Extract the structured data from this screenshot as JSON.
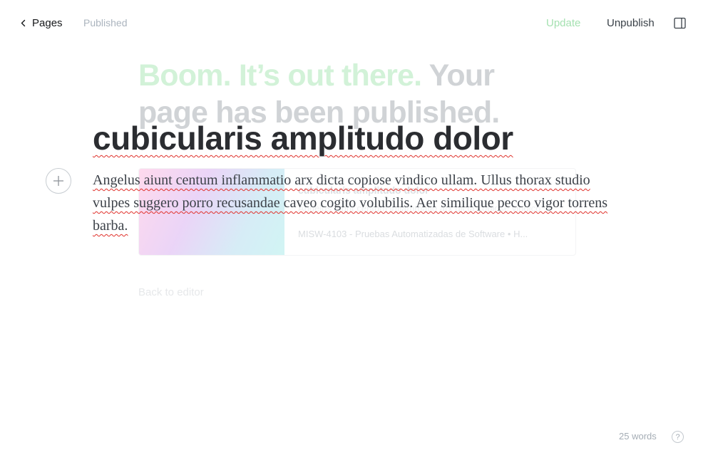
{
  "topbar": {
    "back_label": "Pages",
    "status": "Published",
    "update_label": "Update",
    "unpublish_label": "Unpublish"
  },
  "overlay": {
    "title_accent": "Boom. It’s out there.",
    "title_rest": "Your page has been published.",
    "bookmark": {
      "title": "cubicularis amplitudo dolor",
      "description": "Angelus aiunt centum inflammatio arx dicta copiose vindico",
      "site": "MISW-4103 - Pruebas Automatizadas de Software",
      "separator": "•",
      "author_truncated": "H..."
    },
    "back_to_editor": "Back to editor"
  },
  "editor": {
    "title": "cubicularis amplitudo dolor",
    "body": "Angelus aiunt centum inflammatio arx dicta copiose vindico ullam. Ullus thorax studio vulpes suggero porro recusandae caveo cogito volubilis. Aer similique pecco vigor torrens barba."
  },
  "footer": {
    "word_count": "25 words",
    "help_glyph": "?"
  },
  "colors": {
    "accent_green": "#a5e1b1",
    "text_dark": "#15171a",
    "muted": "#abb4be"
  },
  "icons": {
    "back": "chevron-left-icon",
    "sidebar": "sidebar-toggle-icon",
    "add": "plus-icon",
    "help": "help-icon"
  }
}
